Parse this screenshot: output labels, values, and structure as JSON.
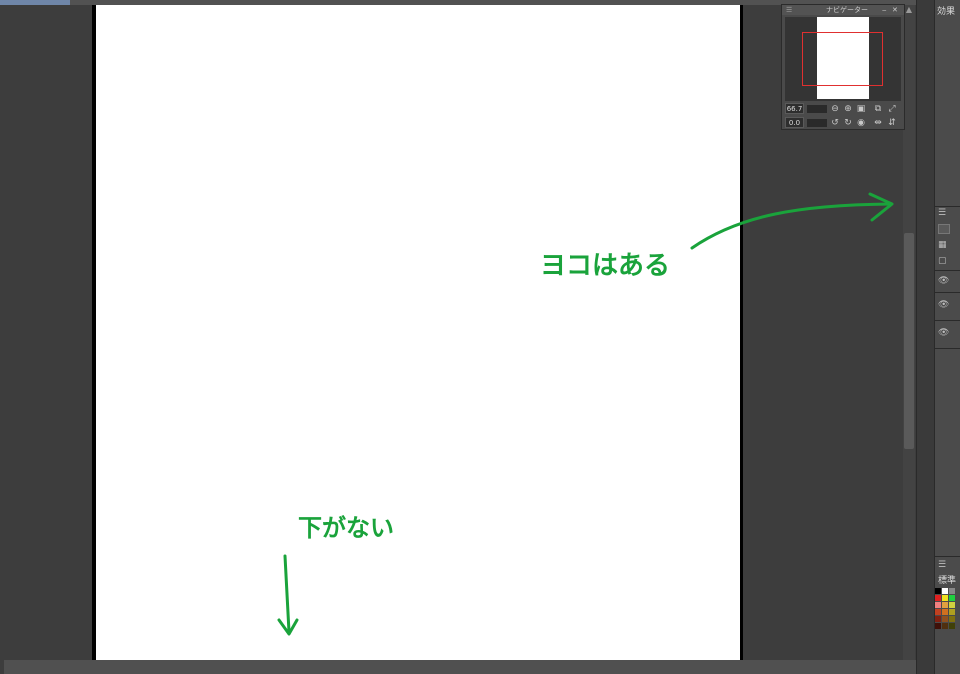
{
  "app": {
    "annotations": {
      "horizontal_note": "ヨコはある",
      "vertical_note": "下がない",
      "color": "#1aa33b"
    },
    "navigator": {
      "title": "ナビゲーター",
      "zoom_value": "66.7",
      "rotate_value": "0.0",
      "icons": {
        "zoom_out": "zoom-out-icon",
        "zoom_in": "zoom-in-icon",
        "actual_size": "actual-size-icon",
        "fit_screen": "fit-screen-icon",
        "fit_window": "fit-window-icon",
        "rotate_left": "rotate-left-icon",
        "rotate_right": "rotate-right-icon",
        "reset_rotate": "reset-rotation-icon",
        "flip_horizontal": "flip-horizontal-icon",
        "flip_vertical": "flip-vertical-icon"
      }
    },
    "right_panel": {
      "effects_tab": "効果",
      "color_set_label": "標準"
    }
  }
}
